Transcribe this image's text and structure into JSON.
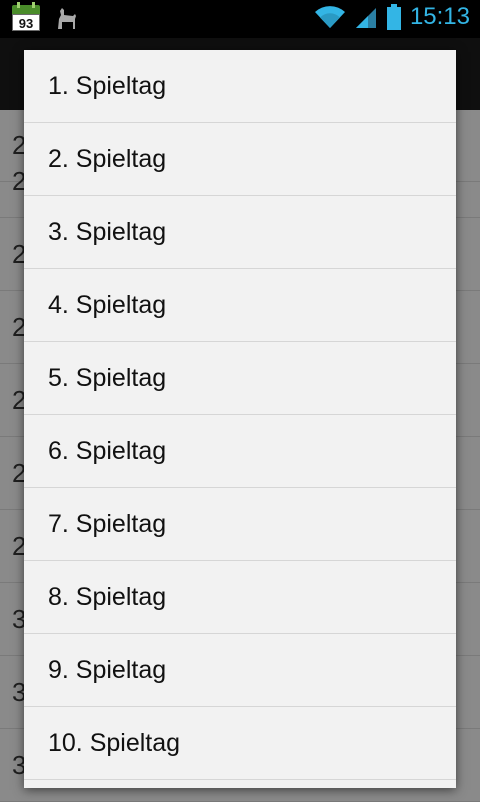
{
  "status_bar": {
    "calendar_day": "93",
    "time": "15:13",
    "icons": [
      "calendar-icon",
      "llama-icon",
      "wifi-icon",
      "signal-icon",
      "battery-icon"
    ]
  },
  "dialog": {
    "items": [
      {
        "label": "1. Spieltag"
      },
      {
        "label": "2. Spieltag"
      },
      {
        "label": "3. Spieltag"
      },
      {
        "label": "4. Spieltag"
      },
      {
        "label": "5. Spieltag"
      },
      {
        "label": "6. Spieltag"
      },
      {
        "label": "7. Spieltag"
      },
      {
        "label": "8. Spieltag"
      },
      {
        "label": "9. Spieltag"
      },
      {
        "label": "10. Spieltag"
      }
    ]
  },
  "background_list": {
    "rows": [
      "2",
      "2",
      "2",
      "2",
      "2",
      "2",
      "2",
      "3",
      "3",
      "3"
    ]
  },
  "colors": {
    "accent": "#33b5e5",
    "dialog_bg": "#f2f2f2",
    "dim_bg": "#8a8a8a"
  }
}
